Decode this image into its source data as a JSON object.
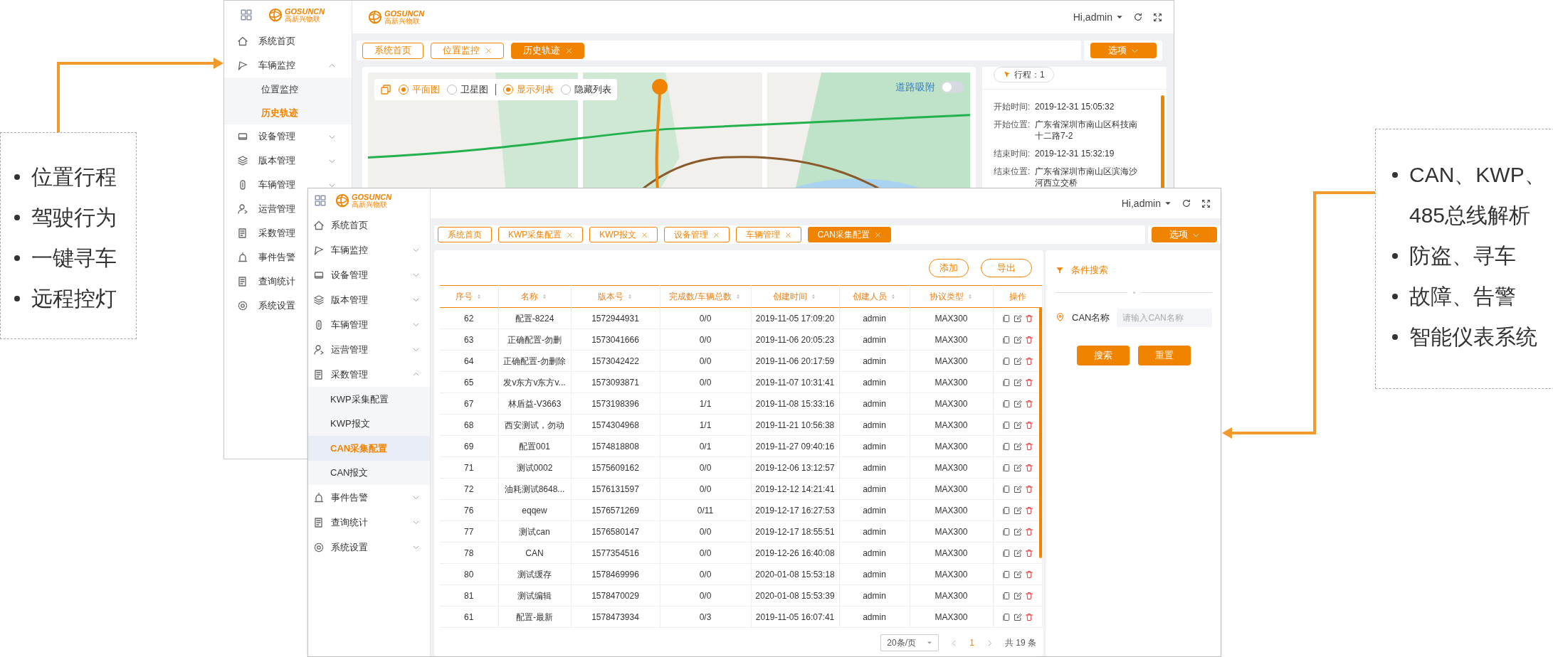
{
  "left_callout": {
    "items": [
      "位置行程",
      "驾驶行为",
      "一键寻车",
      "远程控灯"
    ]
  },
  "history_window": {
    "logo": {
      "brand": "GOSUNCN",
      "tagline": "高新兴物联"
    },
    "header_logo": {
      "brand": "GOSUNCN",
      "tagline": "高新兴物联"
    },
    "user": "Hi,admin",
    "sidebar": [
      {
        "kind": "page",
        "label": "系统首页"
      },
      {
        "kind": "group",
        "label": "车辆监控",
        "expanded": true,
        "children": [
          {
            "label": "位置监控",
            "selected": false
          },
          {
            "label": "历史轨迹",
            "selected": true
          }
        ]
      },
      {
        "kind": "group",
        "label": "设备管理",
        "expanded": false
      },
      {
        "kind": "group",
        "label": "版本管理",
        "expanded": false
      },
      {
        "kind": "group",
        "label": "车辆管理",
        "expanded": false
      },
      {
        "kind": "group",
        "label": "运营管理"
      },
      {
        "kind": "group",
        "label": "采数管理"
      },
      {
        "kind": "group",
        "label": "事件告警"
      },
      {
        "kind": "group",
        "label": "查询统计"
      },
      {
        "kind": "group",
        "label": "系统设置"
      }
    ],
    "tabs": [
      {
        "label": "系统首页",
        "closable": false,
        "selected": false
      },
      {
        "label": "位置监控",
        "closable": true,
        "selected": false
      },
      {
        "label": "历史轨迹",
        "closable": true,
        "selected": true
      }
    ],
    "options_button": "选项",
    "map": {
      "view_options": [
        {
          "label": "平面图",
          "selected": true
        },
        {
          "label": "卫星图",
          "selected": false
        }
      ],
      "list_options": [
        {
          "label": "显示列表",
          "selected": true
        },
        {
          "label": "隐藏列表",
          "selected": false
        }
      ],
      "road_snap": {
        "label": "道路吸附",
        "on": false
      }
    },
    "trip": {
      "label": "行程：1"
    },
    "details": [
      {
        "label": "开始时间:",
        "value": "2019-12-31 15:05:32"
      },
      {
        "label": "开始位置:",
        "value": "广东省深圳市南山区科技南十二路7-2"
      },
      {
        "label": "结束时间:",
        "value": "2019-12-31 15:32:19"
      },
      {
        "label": "结束位置:",
        "value": "广东省深圳市南山区滨海沙河西立交桥"
      }
    ]
  },
  "can_window": {
    "logo": {
      "brand": "GOSUNCN",
      "tagline": "高新兴物联"
    },
    "user": "Hi,admin",
    "sidebar": [
      {
        "kind": "page",
        "label": "系统首页"
      },
      {
        "kind": "group",
        "label": "车辆监控",
        "expanded": false
      },
      {
        "kind": "group",
        "label": "设备管理",
        "expanded": false
      },
      {
        "kind": "group",
        "label": "版本管理",
        "expanded": false
      },
      {
        "kind": "group",
        "label": "车辆管理",
        "expanded": false
      },
      {
        "kind": "group",
        "label": "运营管理",
        "expanded": false
      },
      {
        "kind": "group",
        "label": "采数管理",
        "expanded": true,
        "children": [
          {
            "label": "KWP采集配置",
            "selected": false
          },
          {
            "label": "KWP报文",
            "selected": false
          },
          {
            "label": "CAN采集配置",
            "selected": true
          },
          {
            "label": "CAN报文",
            "selected": false
          }
        ]
      },
      {
        "kind": "group",
        "label": "事件告警",
        "expanded": false
      },
      {
        "kind": "group",
        "label": "查询统计",
        "expanded": false
      },
      {
        "kind": "group",
        "label": "系统设置",
        "expanded": false
      }
    ],
    "tabs": [
      {
        "label": "系统首页",
        "closable": false,
        "selected": false
      },
      {
        "label": "KWP采集配置",
        "closable": true,
        "selected": false
      },
      {
        "label": "KWP报文",
        "closable": true,
        "selected": false
      },
      {
        "label": "设备管理",
        "closable": true,
        "selected": false
      },
      {
        "label": "车辆管理",
        "closable": true,
        "selected": false
      },
      {
        "label": "CAN采集配置",
        "closable": true,
        "selected": true
      }
    ],
    "options_button": "选项",
    "toolbar": [
      "添加",
      "导出"
    ],
    "table": {
      "columns": [
        {
          "label": "序号",
          "sortable": true
        },
        {
          "label": "名称",
          "sortable": true
        },
        {
          "label": "版本号",
          "sortable": true
        },
        {
          "label": "完成数/车辆总数",
          "sortable": true
        },
        {
          "label": "创建时间",
          "sortable": true
        },
        {
          "label": "创建人员",
          "sortable": true
        },
        {
          "label": "协议类型",
          "sortable": true
        },
        {
          "label": "操作",
          "sortable": false
        }
      ],
      "rows": [
        [
          "62",
          "配置-8224",
          "1572944931",
          "0/0",
          "2019-11-05 17:09:20",
          "admin",
          "MAX300"
        ],
        [
          "63",
          "正确配置-勿删",
          "1573041666",
          "0/0",
          "2019-11-06 20:05:23",
          "admin",
          "MAX300"
        ],
        [
          "64",
          "正确配置-勿删除",
          "1573042422",
          "0/0",
          "2019-11-06 20:17:59",
          "admin",
          "MAX300"
        ],
        [
          "65",
          "发v东方v东方v...",
          "1573093871",
          "0/0",
          "2019-11-07 10:31:41",
          "admin",
          "MAX300"
        ],
        [
          "67",
          "林盾益-V3663",
          "1573198396",
          "1/1",
          "2019-11-08 15:33:16",
          "admin",
          "MAX300"
        ],
        [
          "68",
          "西安测试，勿动",
          "1574304968",
          "1/1",
          "2019-11-21 10:56:38",
          "admin",
          "MAX300"
        ],
        [
          "69",
          "配置001",
          "1574818808",
          "0/1",
          "2019-11-27 09:40:16",
          "admin",
          "MAX300"
        ],
        [
          "71",
          "测试0002",
          "1575609162",
          "0/0",
          "2019-12-06 13:12:57",
          "admin",
          "MAX300"
        ],
        [
          "72",
          "油耗测试8648...",
          "1576131597",
          "0/0",
          "2019-12-12 14:21:41",
          "admin",
          "MAX300"
        ],
        [
          "76",
          "eqqew",
          "1576571269",
          "0/11",
          "2019-12-17 16:27:53",
          "admin",
          "MAX300"
        ],
        [
          "77",
          "测试can",
          "1576580147",
          "0/0",
          "2019-12-17 18:55:51",
          "admin",
          "MAX300"
        ],
        [
          "78",
          "CAN",
          "1577354516",
          "0/0",
          "2019-12-26 16:40:08",
          "admin",
          "MAX300"
        ],
        [
          "80",
          "测试缓存",
          "1578469996",
          "0/0",
          "2020-01-08 15:53:18",
          "admin",
          "MAX300"
        ],
        [
          "81",
          "测试编辑",
          "1578470029",
          "0/0",
          "2020-01-08 15:53:39",
          "admin",
          "MAX300"
        ],
        [
          "61",
          "配置-最新",
          "1578473934",
          "0/3",
          "2019-11-05 16:07:41",
          "admin",
          "MAX300"
        ]
      ]
    },
    "pagination": {
      "page_size": "20条/页",
      "pages": [
        {
          "label": "1",
          "selected": true
        }
      ],
      "total": "共 19 条"
    },
    "filter": {
      "title": "条件搜索",
      "fields": [
        {
          "label": "CAN名称",
          "placeholder": "请输入CAN名称"
        }
      ],
      "buttons": [
        "搜索",
        "重置"
      ]
    }
  },
  "right_callout": {
    "items": [
      "CAN、KWP、485总线解析",
      "防盗、寻车",
      "故障、告警",
      "智能仪表系统"
    ]
  }
}
